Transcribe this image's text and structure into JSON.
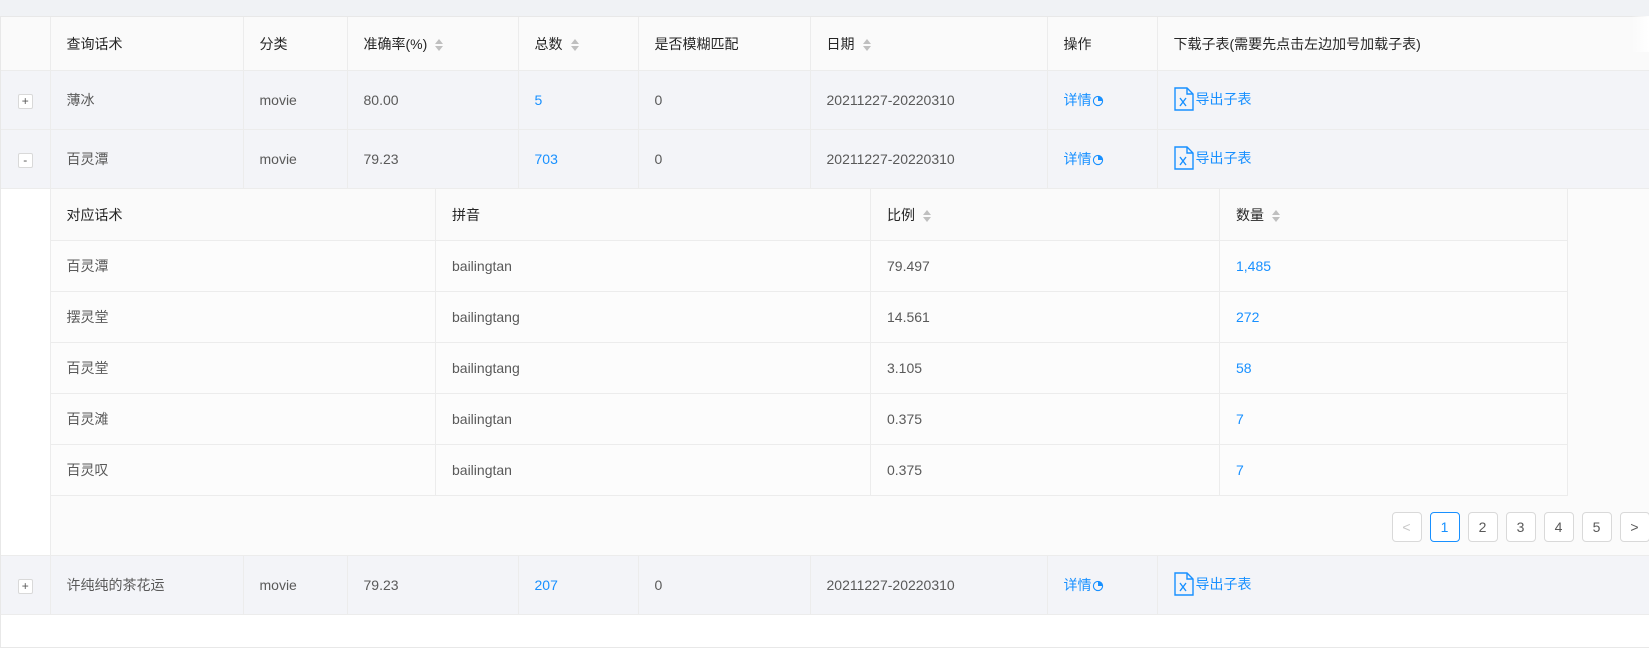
{
  "table": {
    "headers": {
      "query": "查询话术",
      "category": "分类",
      "accuracy": "准确率(%)",
      "total": "总数",
      "fuzzy": "是否模糊匹配",
      "date": "日期",
      "action": "操作",
      "download": "下载子表(需要先点击左边加号加载子表)"
    },
    "rows": [
      {
        "expander": "+",
        "query": "薄冰",
        "category": "movie",
        "accuracy": "80.00",
        "total": "5",
        "fuzzy": "0",
        "date": "20211227-20220310",
        "detail": "详情",
        "export": "导出子表"
      },
      {
        "expander": "-",
        "query": "百灵潭",
        "category": "movie",
        "accuracy": "79.23",
        "total": "703",
        "fuzzy": "0",
        "date": "20211227-20220310",
        "detail": "详情",
        "export": "导出子表"
      },
      {
        "expander": "+",
        "query": "许纯纯的茶花运",
        "category": "movie",
        "accuracy": "79.23",
        "total": "207",
        "fuzzy": "0",
        "date": "20211227-20220310",
        "detail": "详情",
        "export": "导出子表"
      }
    ]
  },
  "subtable": {
    "headers": {
      "phrase": "对应话术",
      "pinyin": "拼音",
      "ratio": "比例",
      "count": "数量"
    },
    "rows": [
      {
        "phrase": "百灵潭",
        "pinyin": "bailingtan",
        "ratio": "79.497",
        "count": "1,485"
      },
      {
        "phrase": "摆灵堂",
        "pinyin": "bailingtang",
        "ratio": "14.561",
        "count": "272"
      },
      {
        "phrase": "百灵堂",
        "pinyin": "bailingtang",
        "ratio": "3.105",
        "count": "58"
      },
      {
        "phrase": "百灵滩",
        "pinyin": "bailingtan",
        "ratio": "0.375",
        "count": "7"
      },
      {
        "phrase": "百灵叹",
        "pinyin": "bailingtan",
        "ratio": "0.375",
        "count": "7"
      }
    ],
    "pagination": {
      "prev": "<",
      "pages": [
        "1",
        "2",
        "3",
        "4",
        "5"
      ],
      "next": ">",
      "current": "1"
    }
  },
  "colors": {
    "link": "#1890ff",
    "row_bg": "#f3f4f8"
  },
  "icons": {
    "detail": "pie-chart-icon",
    "export": "excel-file-icon"
  }
}
